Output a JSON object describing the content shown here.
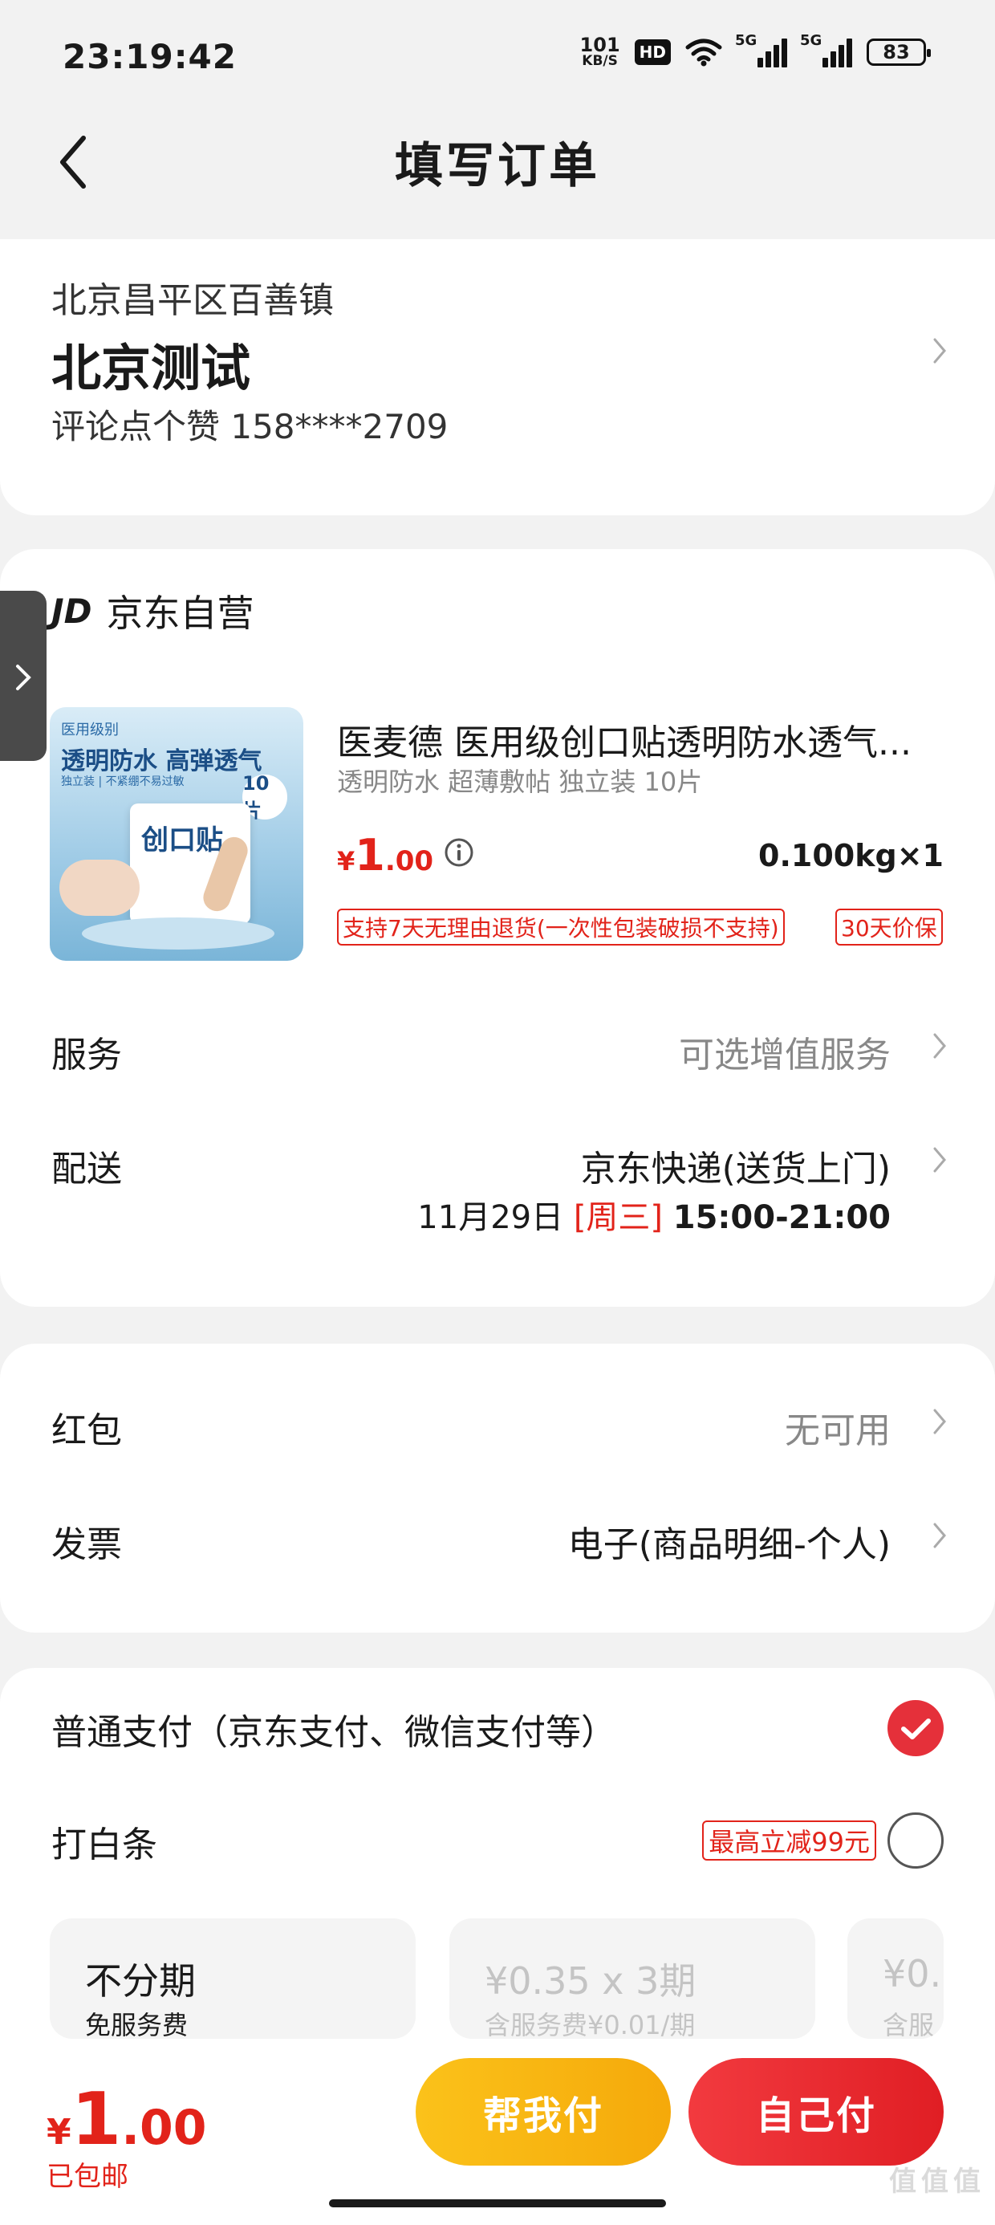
{
  "status_bar": {
    "time": "23:19:42",
    "net_speed_value": "101",
    "net_speed_unit": "KB/S",
    "hd_label": "HD",
    "signal_label_1": "5G",
    "signal_label_2": "5G",
    "battery": "83"
  },
  "nav": {
    "title": "填写订单"
  },
  "address": {
    "region": "北京昌平区百善镇",
    "detail": "北京测试",
    "contact": "评论点个赞  158****2709"
  },
  "shop": {
    "logo": "JD",
    "name": "京东自营"
  },
  "product": {
    "image_label_top": "医用级别",
    "image_title": "透明防水 高弹透气",
    "image_subtitle": "独立装 | 不紧绷不易过敏",
    "image_count": "10片",
    "image_box_text": "创口贴",
    "name": "医麦德 医用级创口贴透明防水透气...",
    "spec": "透明防水 超薄敷帖 独立装 10片",
    "price_currency": "¥",
    "price_int": "1",
    "price_dec": ".00",
    "weight_qty": "0.100kg×1",
    "tags": [
      "支持7天无理由退货(一次性包装破损不支持)",
      "30天价保"
    ]
  },
  "service": {
    "label": "服务",
    "value": "可选增值服务"
  },
  "delivery": {
    "label": "配送",
    "method": "京东快递(送货上门)",
    "date": "11月29日",
    "weekday": "[周三]",
    "time": "15:00-21:00"
  },
  "red_packet": {
    "label": "红包",
    "value": "无可用"
  },
  "invoice": {
    "label": "发票",
    "value": "电子(商品明细-个人)"
  },
  "payment": {
    "normal_label": "普通支付（京东支付、微信支付等）",
    "normal_selected": true,
    "baitiao_label": "打白条",
    "baitiao_promo": "最高立减99元",
    "baitiao_selected": false,
    "installments": [
      {
        "title": "不分期",
        "sub": "免服务费",
        "enabled": true
      },
      {
        "title": "¥0.35 x 3期",
        "sub": "含服务费¥0.01/期",
        "enabled": false
      },
      {
        "title": "¥0.",
        "sub": "含服务",
        "enabled": false
      }
    ]
  },
  "bottom": {
    "currency": "¥",
    "total_int": "1",
    "total_dec": ".00",
    "shipping_note": "已包邮",
    "friend_pay": "帮我付",
    "self_pay": "自己付"
  },
  "watermark": "值值值",
  "colors": {
    "brand_red": "#e2231a",
    "friend_btn": "#f7b512",
    "self_btn": "#e8262c"
  }
}
